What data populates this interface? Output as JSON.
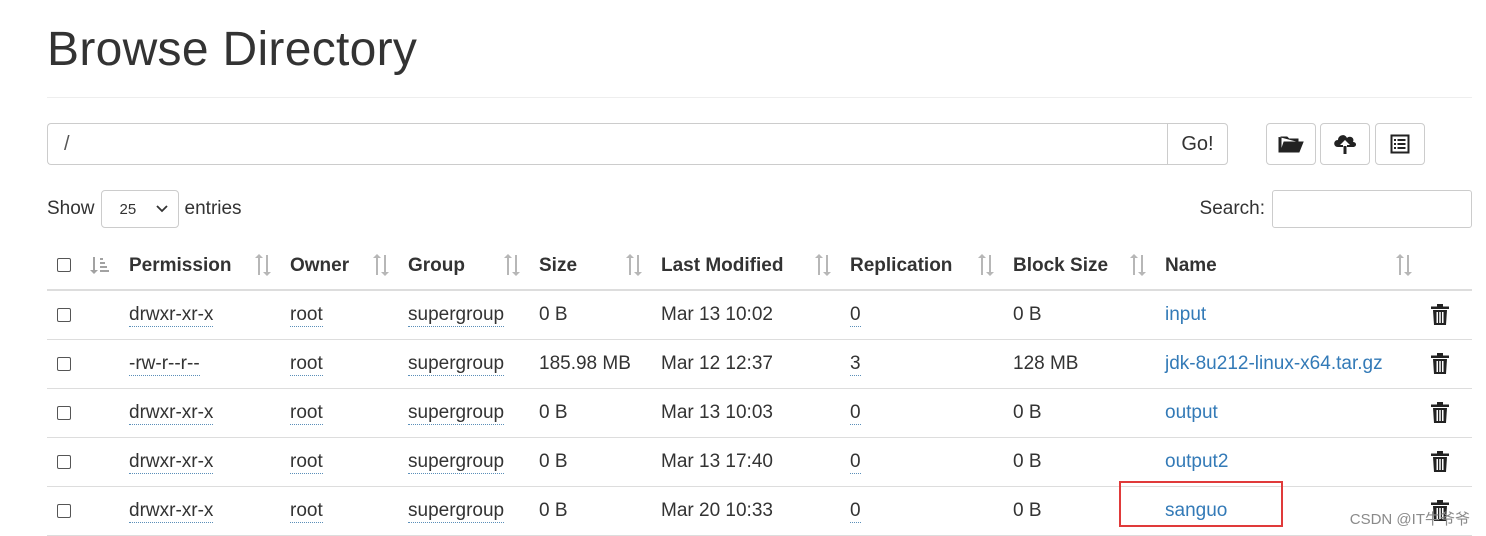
{
  "page": {
    "title": "Browse Directory"
  },
  "path_bar": {
    "path_value": "/",
    "go_label": "Go!"
  },
  "toolbar": {
    "buttons": [
      {
        "icon": "folder-open-icon"
      },
      {
        "icon": "cloud-upload-icon"
      },
      {
        "icon": "list-alt-icon"
      }
    ]
  },
  "show_entries": {
    "show_label": "Show",
    "selected": "25",
    "entries_label": "entries"
  },
  "search": {
    "label": "Search:",
    "value": ""
  },
  "table": {
    "columns": [
      "Permission",
      "Owner",
      "Group",
      "Size",
      "Last Modified",
      "Replication",
      "Block Size",
      "Name"
    ],
    "rows": [
      {
        "permission": "drwxr-xr-x",
        "owner": "root",
        "group": "supergroup",
        "size": "0 B",
        "modified": "Mar 13 10:02",
        "replication": "0",
        "block_size": "0 B",
        "name": "input"
      },
      {
        "permission": "-rw-r--r--",
        "owner": "root",
        "group": "supergroup",
        "size": "185.98 MB",
        "modified": "Mar 12 12:37",
        "replication": "3",
        "block_size": "128 MB",
        "name": "jdk-8u212-linux-x64.tar.gz"
      },
      {
        "permission": "drwxr-xr-x",
        "owner": "root",
        "group": "supergroup",
        "size": "0 B",
        "modified": "Mar 13 10:03",
        "replication": "0",
        "block_size": "0 B",
        "name": "output"
      },
      {
        "permission": "drwxr-xr-x",
        "owner": "root",
        "group": "supergroup",
        "size": "0 B",
        "modified": "Mar 13 17:40",
        "replication": "0",
        "block_size": "0 B",
        "name": "output2"
      },
      {
        "permission": "drwxr-xr-x",
        "owner": "root",
        "group": "supergroup",
        "size": "0 B",
        "modified": "Mar 20 10:33",
        "replication": "0",
        "block_size": "0 B",
        "name": "sanguo"
      }
    ]
  },
  "watermark": "CSDN @IT牛爷爷",
  "colors": {
    "link": "#337ab7",
    "highlight": "#e03a3a",
    "border": "#dddddd"
  }
}
